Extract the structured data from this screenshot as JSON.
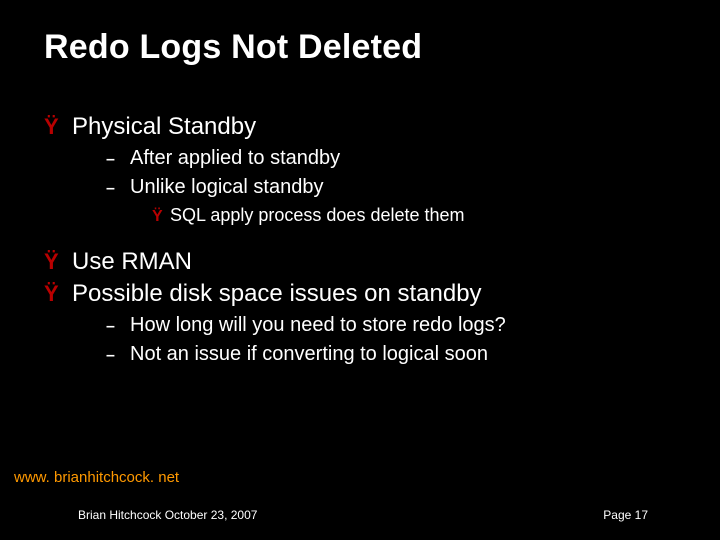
{
  "title": "Redo Logs Not Deleted",
  "markers": {
    "l1": "Ÿ",
    "l2": "–",
    "l3": "Ÿ"
  },
  "body": [
    {
      "text": "Physical Standby",
      "children": [
        {
          "text": "After applied to standby"
        },
        {
          "text": "Unlike logical standby",
          "children": [
            {
              "text": "SQL apply process does delete them"
            }
          ]
        }
      ]
    },
    {
      "text": "Use RMAN"
    },
    {
      "text": "Possible disk space issues on standby",
      "children": [
        {
          "text": "How long will you need to store redo logs?"
        },
        {
          "text": "Not an issue if converting to logical soon"
        }
      ]
    }
  ],
  "footer": {
    "url": "www. brianhitchcock. net",
    "left": "Brian Hitchcock  October 23, 2007",
    "right": "Page 17"
  },
  "colors": {
    "background": "#000000",
    "text": "#ffffff",
    "accent_red": "#b80000",
    "accent_orange": "#ff9900"
  }
}
